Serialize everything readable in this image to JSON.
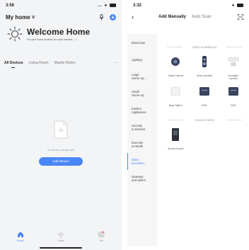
{
  "left": {
    "status_time": "3:56",
    "home_title": "My home",
    "welcome_title": "Welcome Home",
    "welcome_sub": "Set your home location for more informa...",
    "room_tabs": [
      "All Devices",
      "Living Room",
      "Master Bedro",
      "···"
    ],
    "empty_text": "No devices, please add",
    "add_device_label": "Add Device",
    "nav": [
      "Home",
      "Smart",
      "Me"
    ]
  },
  "right": {
    "status_time": "3:32",
    "tabs": [
      "Add Manually",
      "Auto Scan"
    ],
    "categories": [
      "Electrician",
      "Lighting",
      "Large\nHome Ap...",
      "Small\nHome Ap...",
      "Kitchen\nAppliances",
      "Security\n& Sensors",
      "Exercise\n& Health",
      "Video\nSurveillan...",
      "Gateway\nand others"
    ],
    "sections": [
      {
        "title": "Video Surveillance",
        "devices": [
          "Smart Camera",
          "Smart Doorbell",
          "Floodlight\nCamera",
          "Base Station",
          "NVR",
          "DVR"
        ]
      },
      {
        "title": "Access Control",
        "devices": [
          "Access Control"
        ]
      }
    ]
  },
  "colors": {
    "accent": "#4a86f5"
  }
}
